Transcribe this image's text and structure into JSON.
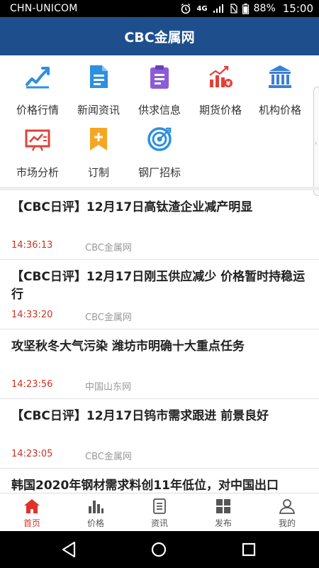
{
  "status": {
    "carrier": "CHN-UNICOM",
    "network": "4G",
    "battery": "88%",
    "time": "15:00"
  },
  "header": {
    "title": "CBC金属网"
  },
  "grid": [
    {
      "label": "价格行情",
      "icon": "price-chart-icon"
    },
    {
      "label": "新闻资讯",
      "icon": "news-document-icon"
    },
    {
      "label": "供求信息",
      "icon": "clipboard-icon"
    },
    {
      "label": "期货价格",
      "icon": "futures-bars-icon"
    },
    {
      "label": "机构价格",
      "icon": "institution-icon"
    },
    {
      "label": "市场分析",
      "icon": "market-analysis-icon"
    },
    {
      "label": "订制",
      "icon": "subscribe-bookmark-icon"
    },
    {
      "label": "钢厂招标",
      "icon": "target-icon"
    }
  ],
  "news": [
    {
      "title": "【CBC日评】12月17日高钛渣企业减产明显",
      "time": "14:36:13",
      "source": "CBC金属网"
    },
    {
      "title": "【CBC日评】12月17日刚玉供应减少 价格暂时持稳运行",
      "time": "14:33:20",
      "source": "CBC金属网"
    },
    {
      "title": "攻坚秋冬大气污染 潍坊市明确十大重点任务",
      "time": "14:23:56",
      "source": "中国山东网"
    },
    {
      "title": "【CBC日评】12月17日钨市需求跟进 前景良好",
      "time": "14:23:05",
      "source": "CBC金属网"
    },
    {
      "title": "韩国2020年钢材需求料创11年低位，对中国出口",
      "time": "",
      "source": ""
    }
  ],
  "tabs": [
    {
      "label": "首页",
      "icon": "home-icon",
      "active": true
    },
    {
      "label": "价格",
      "icon": "bar-chart-icon",
      "active": false
    },
    {
      "label": "资讯",
      "icon": "document-icon",
      "active": false
    },
    {
      "label": "发布",
      "icon": "grid-icon",
      "active": false
    },
    {
      "label": "我的",
      "icon": "user-icon",
      "active": false
    }
  ],
  "colors": {
    "header": "#1e4f8c",
    "accent_red": "#e0312a",
    "icon_blue": "#2f8fe0",
    "icon_purple": "#8b5cd6",
    "icon_red": "#e2403a",
    "icon_orange": "#f5a623"
  }
}
